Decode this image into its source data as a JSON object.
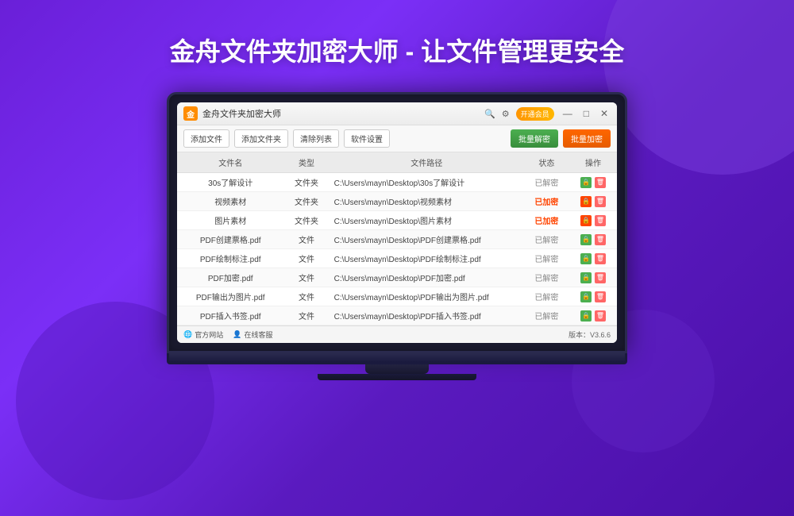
{
  "page": {
    "title": "金舟文件夹加密大师 - 让文件管理更安全",
    "bg_color": "#7b2ff7"
  },
  "app": {
    "icon_text": "金",
    "title": "金舟文件夹加密大师",
    "vip_label": "开通会员",
    "win_buttons": [
      "—",
      "□",
      "✕"
    ]
  },
  "toolbar": {
    "add_file": "添加文件",
    "add_folder": "添加文件夹",
    "clear_list": "清除列表",
    "settings": "软件设置",
    "batch_decrypt": "批量解密",
    "batch_encrypt": "批量加密"
  },
  "table": {
    "headers": [
      "文件名",
      "类型",
      "文件路径",
      "状态",
      "操作"
    ],
    "rows": [
      {
        "name": "30s了解设计",
        "type": "文件夹",
        "path": "C:\\Users\\mayn\\Desktop\\30s了解设计",
        "status": "已解密",
        "locked": false
      },
      {
        "name": "视频素材",
        "type": "文件夹",
        "path": "C:\\Users\\mayn\\Desktop\\视频素材",
        "status": "已加密",
        "locked": true
      },
      {
        "name": "图片素材",
        "type": "文件夹",
        "path": "C:\\Users\\mayn\\Desktop\\图片素材",
        "status": "已加密",
        "locked": true
      },
      {
        "name": "PDF创建票格.pdf",
        "type": "文件",
        "path": "C:\\Users\\mayn\\Desktop\\PDF创建票格.pdf",
        "status": "已解密",
        "locked": false
      },
      {
        "name": "PDF绘制标注.pdf",
        "type": "文件",
        "path": "C:\\Users\\mayn\\Desktop\\PDF绘制标注.pdf",
        "status": "已解密",
        "locked": false
      },
      {
        "name": "PDF加密.pdf",
        "type": "文件",
        "path": "C:\\Users\\mayn\\Desktop\\PDF加密.pdf",
        "status": "已解密",
        "locked": false
      },
      {
        "name": "PDF输出为图片.pdf",
        "type": "文件",
        "path": "C:\\Users\\mayn\\Desktop\\PDF输出为图片.pdf",
        "status": "已解密",
        "locked": false
      },
      {
        "name": "PDF插入书签.pdf",
        "type": "文件",
        "path": "C:\\Users\\mayn\\Desktop\\PDF插入书签.pdf",
        "status": "已解密",
        "locked": false
      }
    ]
  },
  "status_bar": {
    "website": "官方网站",
    "support": "在线客服",
    "version": "版本：V3.6.6"
  },
  "icons": {
    "website_icon": "🌐",
    "support_icon": "👤"
  }
}
